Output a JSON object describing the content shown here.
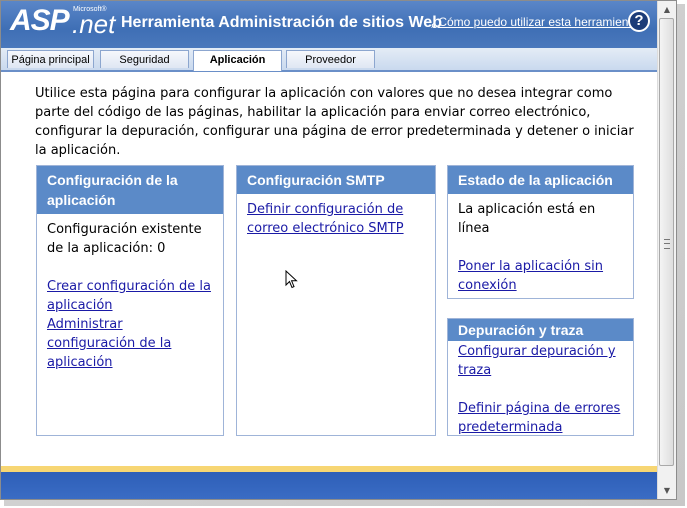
{
  "header": {
    "logo_asp": "ASP",
    "logo_microsoft": "Microsoft®",
    "logo_net": ".net",
    "title": "Herramienta Administración de sitios Web",
    "help_link": "¿Cómo puedo utilizar esta herramienta?",
    "help_icon": "?"
  },
  "tabs": [
    {
      "label": "Página principal",
      "active": false
    },
    {
      "label": "Seguridad",
      "active": false
    },
    {
      "label": "Aplicación",
      "active": true
    },
    {
      "label": "Proveedor",
      "active": false
    }
  ],
  "intro": "Utilice esta página para configurar la aplicación con valores que no desea integrar como parte del código de las páginas, habilitar la aplicación para enviar correo electrónico, configurar la depuración, configurar una página de error predeterminada y detener o iniciar la aplicación.",
  "app_config": {
    "title": "Configuración de la aplicación",
    "existing": "Configuración existente de la aplicación: 0",
    "create_link": "Crear configuración de la aplicación",
    "manage_link": "Administrar configuración de la aplicación"
  },
  "smtp": {
    "title": "Configuración SMTP",
    "define_link": "Definir configuración de correo electrónico SMTP"
  },
  "app_status": {
    "title": "Estado de la aplicación",
    "status": "La aplicación está en línea",
    "offline_link": "Poner la aplicación sin conexión"
  },
  "debug": {
    "title": "Depuración y traza",
    "configure_link": "Configurar depuración y traza",
    "error_page_link": "Definir página de errores predeterminada"
  },
  "colors": {
    "header_blue": "#4a78bc",
    "box_header": "#5b8ac8",
    "link": "#1a1aa6",
    "footer_yellow": "#f7d673",
    "footer_blue": "#2e5fb8"
  },
  "icons": {
    "help": "help-icon",
    "scroll_up": "scroll-up-arrow-icon",
    "scroll_down": "scroll-down-arrow-icon",
    "cursor": "mouse-pointer-icon"
  }
}
